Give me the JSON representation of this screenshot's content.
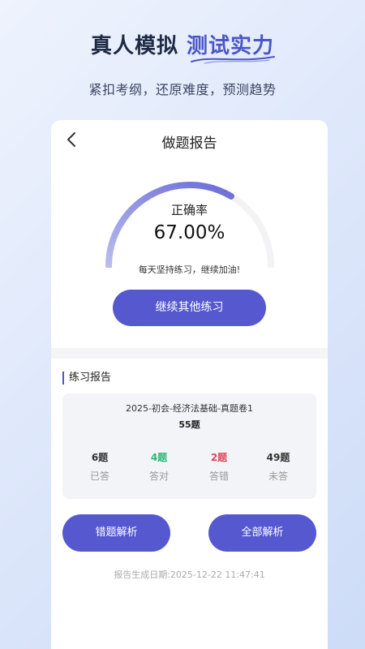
{
  "hero": {
    "title_main": "真人模拟",
    "title_accent": "测试实力",
    "subtitle": "紧扣考纲，还原难度，预测趋势"
  },
  "nav": {
    "title": "做题报告",
    "back_icon": "chevron-left-icon"
  },
  "result": {
    "accuracy_label": "正确率",
    "accuracy_value": "67.00%",
    "accuracy_fraction": 0.67,
    "encouragement": "每天坚持练习，继续加油!",
    "continue_button": "继续其他练习"
  },
  "practice_report": {
    "section_title": "练习报告",
    "paper_name": "2025-初会-经济法基础-真题卷1",
    "question_count": "55题",
    "stats": [
      {
        "value": "6题",
        "label": "已答",
        "color": "#333333"
      },
      {
        "value": "4题",
        "label": "答对",
        "color": "#2bb673"
      },
      {
        "value": "2题",
        "label": "答错",
        "color": "#e0475a"
      },
      {
        "value": "49题",
        "label": "未答",
        "color": "#333333"
      }
    ]
  },
  "actions": {
    "wrong_analysis": "错题解析",
    "all_analysis": "全部解析"
  },
  "footer": {
    "report_date": "报告生成日期:2025-12-22 11:47:41"
  },
  "colors": {
    "accent": "#5558cf",
    "gauge_start": "#b9bcef",
    "gauge_end": "#6a6cd6",
    "gauge_track": "#f3f3f5"
  }
}
